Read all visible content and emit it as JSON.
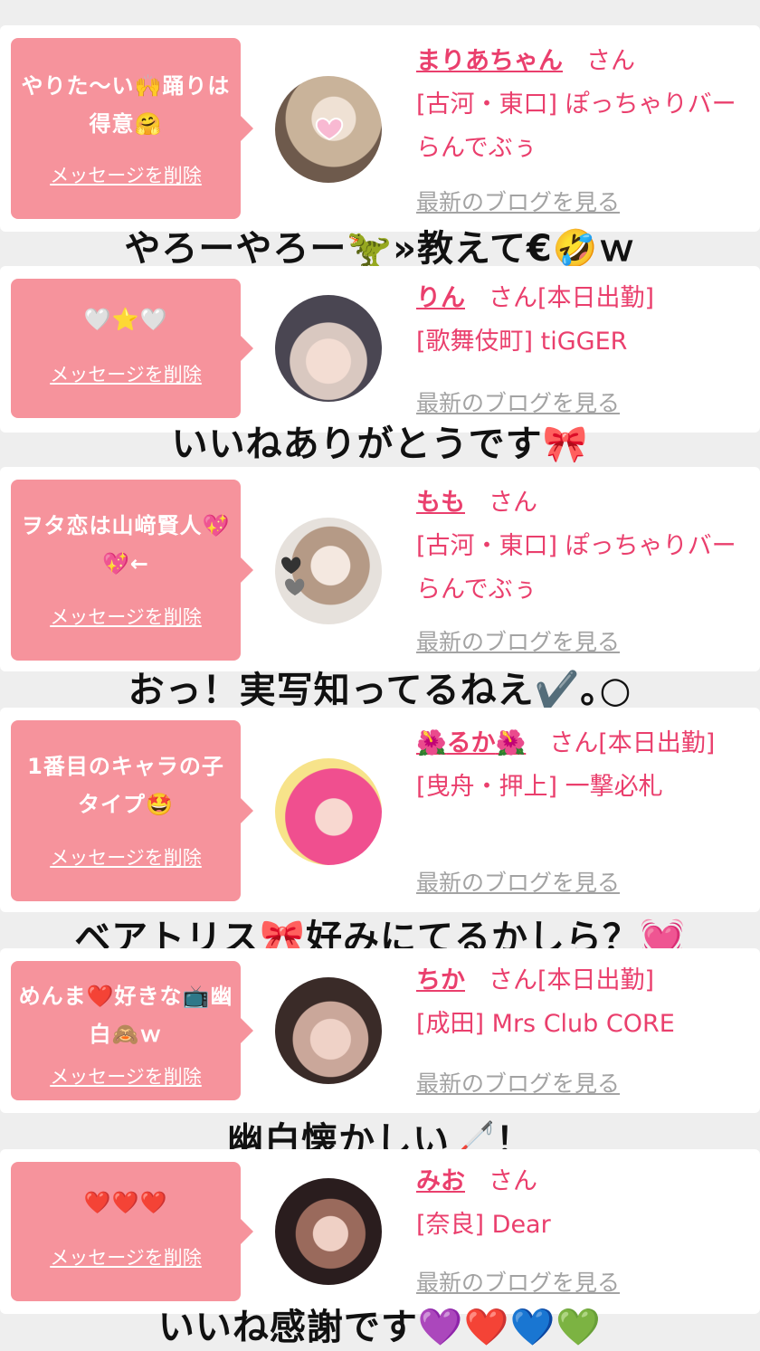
{
  "posts": [
    {
      "message": "やりた〜い🙌踊りは得意🤗",
      "delete_label": "メッセージを削除",
      "name": "まりあちゃん",
      "san": "さん",
      "shop": "[古河・東口] ぽっちゃりバー らんでぶぅ",
      "blog_label": "最新のブログを見る",
      "caption": "やろーやろー🦖»教えて€🤣ｗ",
      "avatar_colors": [
        "#c9b39a",
        "#6e5a4c"
      ]
    },
    {
      "message": "🤍⭐🤍",
      "delete_label": "メッセージを削除",
      "name": "りん",
      "san": "さん[本日出勤]",
      "shop": "[歌舞伎町] tiGGER",
      "blog_label": "最新のブログを見る",
      "caption": "いいねありがとうです🎀",
      "avatar_colors": [
        "#d9c8c0",
        "#4a4652"
      ]
    },
    {
      "message": "ヲタ恋は山﨑賢人💖💖←",
      "delete_label": "メッセージを削除",
      "name": "もも",
      "san": "さん",
      "shop": "[古河・東口] ぽっちゃりバー らんでぶぅ",
      "blog_label": "最新のブログを見る",
      "caption": "おっ！実写知ってるねえ✔️｡○",
      "avatar_colors": [
        "#e6e1dc",
        "#8f7a6a"
      ]
    },
    {
      "message": "1番目のキャラの子タイプ🤩",
      "delete_label": "メッセージを削除",
      "name_prefix": "🌺",
      "name": "るか",
      "name_suffix": "🌺",
      "san": "さん[本日出勤]",
      "shop": "[曳舟・押上] 一撃必札",
      "blog_label": "最新のブログを見る",
      "caption": "ベアトリス🎀好みにてるかしら？💓",
      "avatar_colors": [
        "#f04f8f",
        "#f7e38a"
      ]
    },
    {
      "message": "めんま❤️好きな📺幽白🙈ｗ",
      "delete_label": "メッセージを削除",
      "name": "ちか",
      "san": "さん[本日出勤]",
      "shop": "[成田] Mrs Club CORE",
      "blog_label": "最新のブログを見る",
      "caption": "幽白懐かしい🦯！",
      "avatar_colors": [
        "#caa79a",
        "#3a2b28"
      ]
    },
    {
      "message": "❤️❤️❤️",
      "delete_label": "メッセージを削除",
      "name": "みお",
      "san": "さん",
      "shop": "[奈良] Dear",
      "blog_label": "最新のブログを見る",
      "caption": "いいね感謝です💜❤️💙💚",
      "avatar_colors": [
        "#9a6a5c",
        "#2a1d1e"
      ]
    }
  ],
  "colors": {
    "bubble": "#f6939c",
    "name": "#ea3f6d",
    "blog_link": "#a3a3a3",
    "background": "#eeeeee"
  }
}
